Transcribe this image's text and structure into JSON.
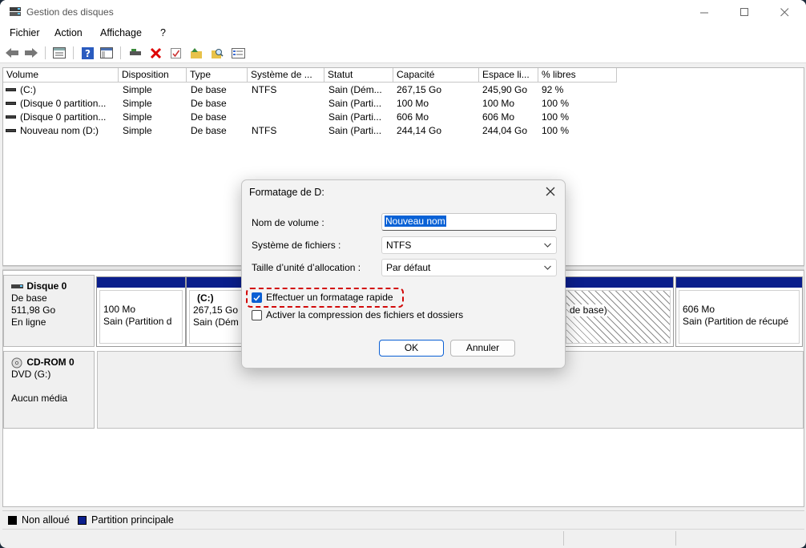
{
  "window": {
    "title": "Gestion des disques"
  },
  "menu": [
    "Fichier",
    "Action",
    "Affichage",
    "?"
  ],
  "volume_list": {
    "columns": [
      "Volume",
      "Disposition",
      "Type",
      "Système de ...",
      "Statut",
      "Capacité",
      "Espace li...",
      "% libres"
    ],
    "rows": [
      [
        "(C:)",
        "Simple",
        "De base",
        "NTFS",
        "Sain (Dém...",
        "267,15 Go",
        "245,90 Go",
        "92 %"
      ],
      [
        "(Disque 0 partition...",
        "Simple",
        "De base",
        "",
        "Sain (Parti...",
        "100 Mo",
        "100 Mo",
        "100 %"
      ],
      [
        "(Disque 0 partition...",
        "Simple",
        "De base",
        "",
        "Sain (Parti...",
        "606 Mo",
        "606 Mo",
        "100 %"
      ],
      [
        "Nouveau nom (D:)",
        "Simple",
        "De base",
        "NTFS",
        "Sain (Parti...",
        "244,14 Go",
        "244,04 Go",
        "100 %"
      ]
    ]
  },
  "disk0": {
    "name": "Disque 0",
    "type": "De base",
    "size": "511,98 Go",
    "status": "En ligne",
    "partitions": [
      {
        "line1": "",
        "line2": "100 Mo",
        "line3": "Sain (Partition d"
      },
      {
        "line1": "(C:)",
        "line2": "267,15 Go",
        "line3": "Sain (Dém"
      },
      {
        "line1": "",
        "line2": "",
        "line3": "de base)"
      },
      {
        "line1": "",
        "line2": "606 Mo",
        "line3": "Sain (Partition de récupé"
      }
    ]
  },
  "cdrom": {
    "name": "CD-ROM 0",
    "type": "DVD (G:)",
    "status": "Aucun média"
  },
  "legend": [
    {
      "label": "Non alloué",
      "color": "#000000"
    },
    {
      "label": "Partition principale",
      "color": "#0a1e8c"
    }
  ],
  "dialog": {
    "title": "Formatage de D:",
    "volume_label": "Nom de volume :",
    "volume_value": "Nouveau nom",
    "fs_label": "Système de fichiers :",
    "fs_value": "NTFS",
    "alloc_label": "Taille d’unité d’allocation :",
    "alloc_value": "Par défaut",
    "quick_format": "Effectuer un formatage rapide",
    "quick_format_checked": true,
    "compression": "Activer la compression des fichiers et dossiers",
    "compression_checked": false,
    "ok": "OK",
    "cancel": "Annuler"
  },
  "colors": {
    "accent": "#0a5fd4",
    "highlight": "#d20a0a",
    "partition_bar": "#0a1e8c"
  }
}
